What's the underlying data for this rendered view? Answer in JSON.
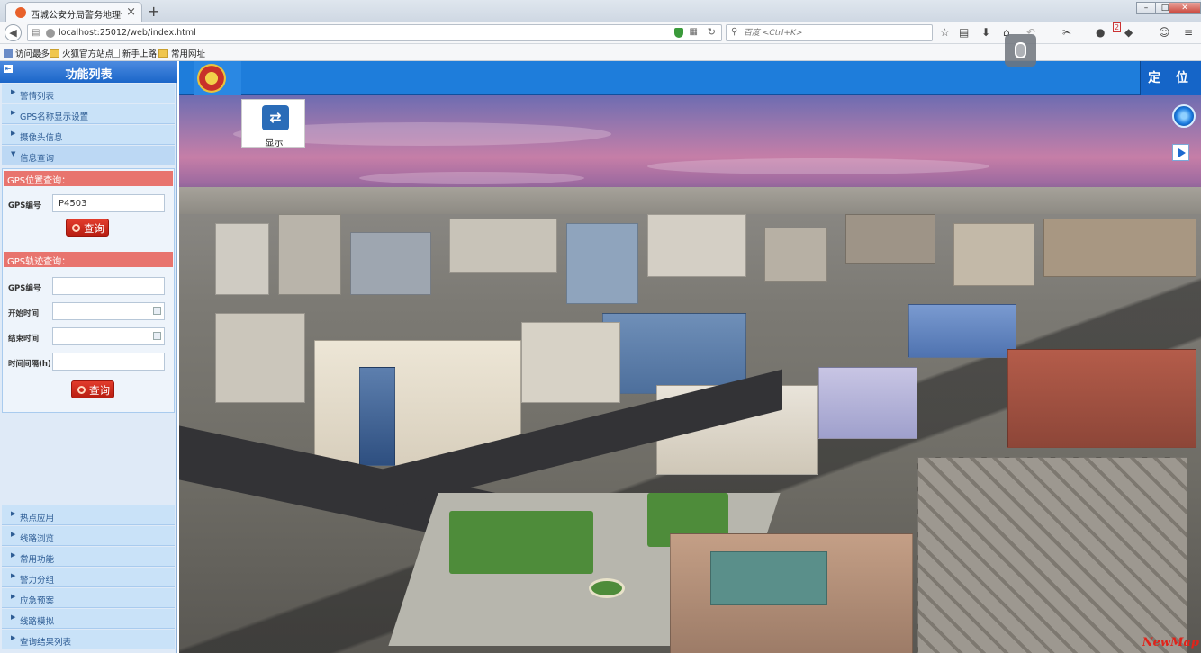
{
  "browser": {
    "tab_title": "西城公安分局警务地理信...",
    "url": "localhost:25012/web/index.html",
    "search_placeholder": "百度 <Ctrl+K>",
    "notification_count": "2",
    "bookmarks": [
      "访问最多",
      "火狐官方站点",
      "新手上路",
      "常用网址"
    ]
  },
  "sidebar": {
    "title": "功能列表",
    "top_items": [
      "警情列表",
      "GPS名称显示设置",
      "摄像头信息",
      "信息查询"
    ],
    "gps_position": {
      "header": "GPS位置查询：",
      "gps_label": "GPS编号",
      "gps_value": "P4503",
      "query_label": "查询"
    },
    "gps_track": {
      "header": "GPS轨迹查询：",
      "gps_label": "GPS编号",
      "start_label": "开始时间",
      "end_label": "结束时间",
      "interval_label": "时间间隔(h)",
      "query_label": "查询"
    },
    "bottom_items": [
      "热点应用",
      "线路浏览",
      "常用功能",
      "警力分组",
      "应急预案",
      "线路模拟",
      "查询结果列表"
    ]
  },
  "map": {
    "locate_label": "定 位",
    "display_label": "显示",
    "watermark": "NewMap"
  },
  "colors": {
    "accent": "#1e7ddb",
    "section_header": "#e8746e",
    "query_button": "#d12d20",
    "sidebar_item": "#c9e2f8"
  }
}
